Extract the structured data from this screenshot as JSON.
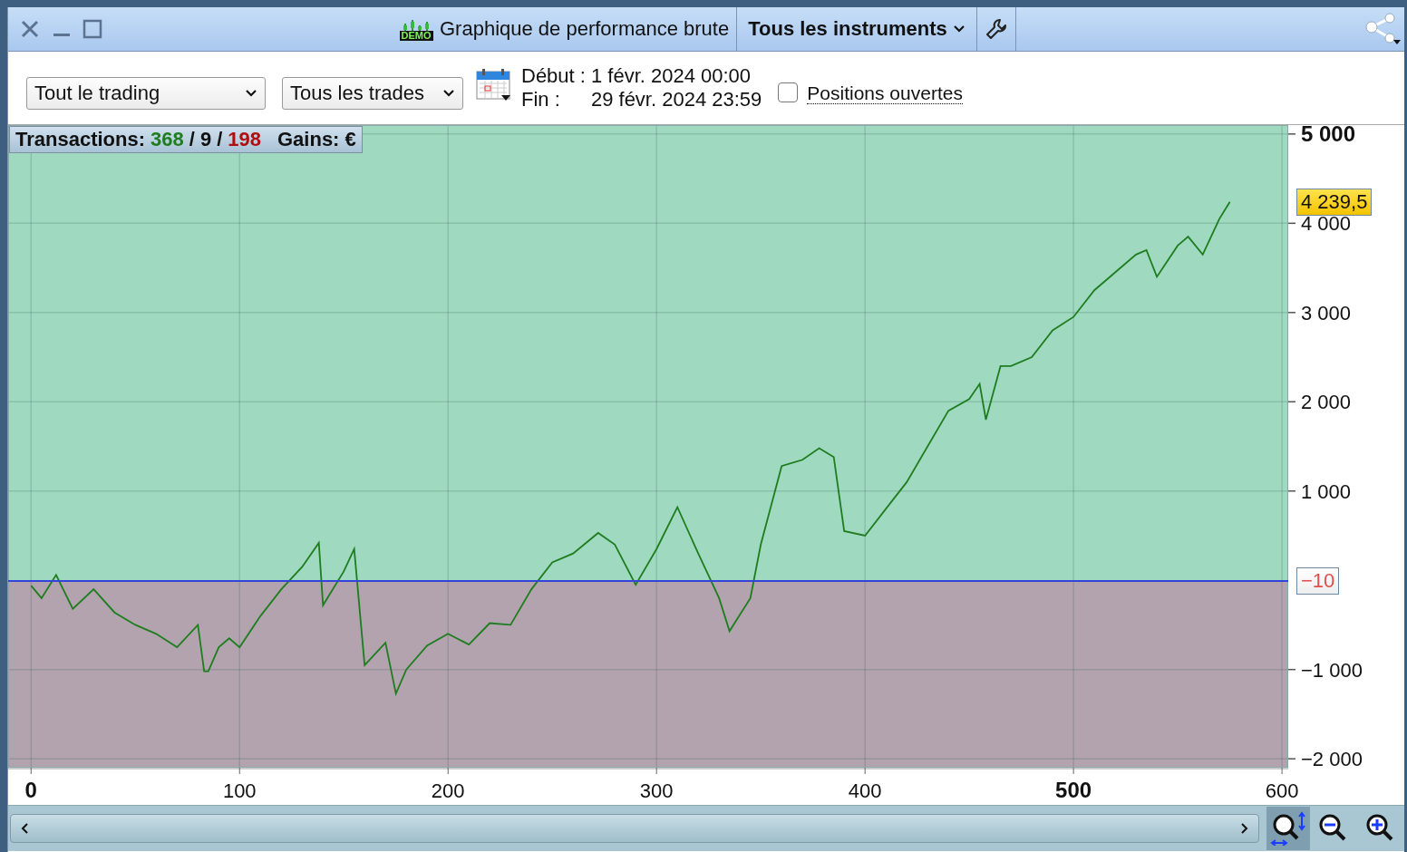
{
  "window": {
    "title": "Graphique de performance brute",
    "badge": "DEMO",
    "instrument_menu": "Tous les instruments"
  },
  "filters": {
    "scope": "Tout le trading",
    "trades": "Tous les trades",
    "start_label": "Début :",
    "start": "1 févr. 2024 00:00",
    "end_label": "Fin :",
    "end": "29 févr. 2024 23:59",
    "open_positions": {
      "label": "Positions ouvertes",
      "checked": false
    }
  },
  "stats": {
    "label": "Transactions:",
    "wins": "368",
    "separator_1": "/",
    "even": "9",
    "separator_2": "/",
    "losses": "198",
    "gains_label": "Gains:",
    "gains": "€"
  },
  "chart_data": {
    "type": "line",
    "x": [
      0,
      5,
      12,
      20,
      30,
      40,
      50,
      60,
      70,
      80,
      83,
      85,
      90,
      95,
      100,
      110,
      120,
      130,
      138,
      140,
      150,
      155,
      160,
      170,
      175,
      180,
      190,
      200,
      210,
      220,
      230,
      240,
      250,
      260,
      272,
      280,
      290,
      300,
      310,
      320,
      330,
      335,
      345,
      350,
      360,
      370,
      378,
      385,
      390,
      400,
      410,
      420,
      430,
      440,
      450,
      455,
      458,
      465,
      470,
      480,
      490,
      500,
      510,
      520,
      530,
      535,
      540,
      550,
      555,
      562,
      570,
      575
    ],
    "series": [
      {
        "color": "#1e7d1e",
        "values": [
          -60,
          -200,
          60,
          -320,
          -100,
          -360,
          -500,
          -600,
          -750,
          -500,
          -1020,
          -1020,
          -750,
          -650,
          -750,
          -400,
          -100,
          150,
          420,
          -280,
          100,
          350,
          -950,
          -700,
          -1270,
          -1000,
          -730,
          -600,
          -720,
          -480,
          -500,
          -100,
          200,
          300,
          530,
          400,
          -50,
          350,
          820,
          300,
          -200,
          -570,
          -200,
          400,
          1280,
          1350,
          1480,
          1380,
          550,
          500,
          800,
          1100,
          1500,
          1900,
          2030,
          2200,
          1800,
          2400,
          2400,
          2500,
          2800,
          2950,
          3250,
          3450,
          3650,
          3700,
          3400,
          3750,
          3850,
          3650,
          4050,
          4240
        ]
      }
    ],
    "xlim": [
      -11,
      603
    ],
    "ylim": [
      -2100,
      5100
    ],
    "xticks": [
      0,
      100,
      200,
      300,
      400,
      500,
      600
    ],
    "yticks": [
      {
        "value": -2000,
        "label": "−2 000"
      },
      {
        "value": -1000,
        "label": "−1 000"
      },
      {
        "value": 1000,
        "label": "1 000"
      },
      {
        "value": 2000,
        "label": "2 000"
      },
      {
        "value": 3000,
        "label": "3 000"
      },
      {
        "value": 4000,
        "label": "4 000"
      },
      {
        "value": 5000,
        "label": "5 000"
      }
    ],
    "grid": true,
    "bands": [
      {
        "axis": "y",
        "from": -10,
        "to": 5100,
        "color": "#9fd9c0"
      },
      {
        "axis": "y",
        "from": -2100,
        "to": -10,
        "color": "#b3a3ae"
      }
    ],
    "annotations": [
      "4 239,5"
    ],
    "ref_lines": [
      {
        "axis": "y",
        "value": -10,
        "label": "−10"
      }
    ]
  }
}
